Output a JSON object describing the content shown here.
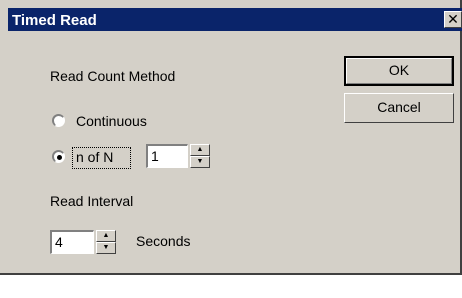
{
  "window": {
    "title": "Timed Read",
    "close_glyph": "✕"
  },
  "read_count": {
    "heading": "Read Count Method",
    "options": [
      {
        "label": "Continuous",
        "selected": false
      },
      {
        "label": "n of N",
        "selected": true
      }
    ],
    "n_value": "1"
  },
  "read_interval": {
    "heading": "Read Interval",
    "value": "4",
    "unit": "Seconds"
  },
  "buttons": {
    "ok": "OK",
    "cancel": "Cancel"
  },
  "spinner": {
    "up_glyph": "▲",
    "down_glyph": "▼"
  }
}
